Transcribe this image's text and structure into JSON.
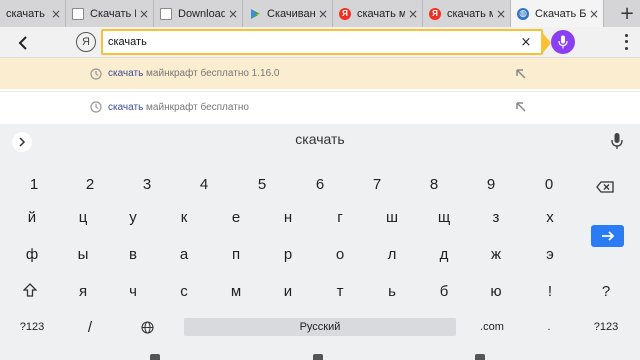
{
  "tabs": [
    {
      "title": "скачать м",
      "icon": "tab-partial-icon",
      "close": "×"
    },
    {
      "title": "Скачать Б",
      "icon": "document-icon",
      "close": "×"
    },
    {
      "title": "Download",
      "icon": "document-icon",
      "close": "×"
    },
    {
      "title": "Скачиван",
      "icon": "play-store-icon",
      "close": "×"
    },
    {
      "title": "скачать м",
      "icon": "yandex-icon",
      "close": "×"
    },
    {
      "title": "скачать м",
      "icon": "yandex-icon",
      "close": "×"
    },
    {
      "title": "Скачать Б",
      "icon": "globe-icon",
      "close": "×",
      "active": true
    }
  ],
  "new_tab": "+",
  "address_bar": {
    "yandex_letter": "Я",
    "value": "скачать",
    "clear": "×"
  },
  "suggestions": [
    {
      "query": "скачать",
      "rest": " майнкрафт бесплатно 1.16.0",
      "highlighted": true
    },
    {
      "query": "скачать",
      "rest": " майнкрафт бесплатно",
      "highlighted": false
    }
  ],
  "keyboard": {
    "candidate": "скачать",
    "number_row": [
      "1",
      "2",
      "3",
      "4",
      "5",
      "6",
      "7",
      "8",
      "9",
      "0"
    ],
    "row1": [
      "й",
      "ц",
      "у",
      "к",
      "е",
      "н",
      "г",
      "ш",
      "щ",
      "з",
      "х"
    ],
    "row2": [
      "ф",
      "ы",
      "в",
      "а",
      "п",
      "р",
      "о",
      "л",
      "д",
      "ж",
      "э"
    ],
    "row3": [
      "я",
      "ч",
      "с",
      "м",
      "и",
      "т",
      "ь",
      "б",
      "ю",
      "!",
      "?"
    ],
    "bottom": {
      "symbols_left": "?123",
      "slash": "/",
      "space_label": "Русский",
      "dotcom": ".com",
      "dot": ".",
      "symbols_right": "?123"
    }
  },
  "colors": {
    "omnibox_border": "#f9c233",
    "voice_button": "#8c3ff2",
    "suggestion_highlight": "#fbeed0",
    "enter_key": "#2a7bf4",
    "yandex_red": "#ef3124"
  }
}
